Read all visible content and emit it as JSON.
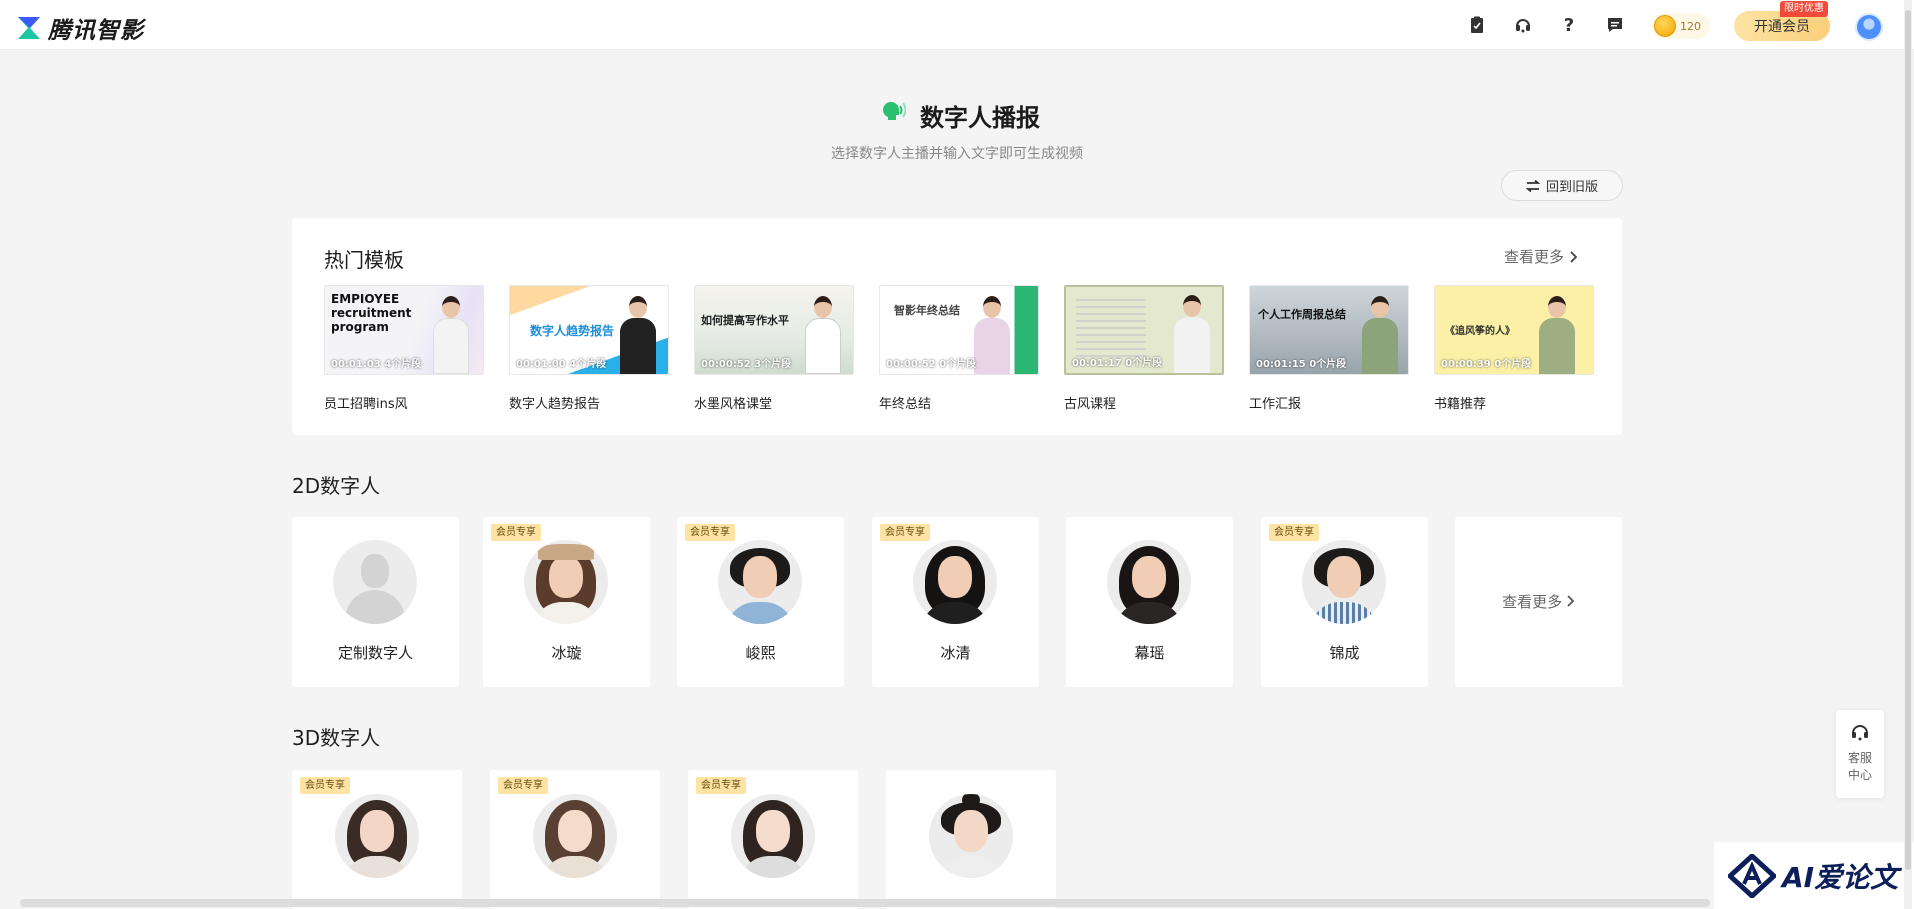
{
  "app": {
    "name": "腾讯智影"
  },
  "topbar": {
    "icons": [
      "clipboard-icon",
      "headset-icon",
      "help-icon",
      "message-icon"
    ],
    "coins": "120",
    "vip_button": "开通会员",
    "vip_tag": "限时优惠"
  },
  "header": {
    "title": "数字人播报",
    "subtitle": "选择数字人主播并输入文字即可生成视频",
    "old_version": "回到旧版"
  },
  "hot": {
    "title": "热门模板",
    "more": "查看更多",
    "templates": [
      {
        "name": "员工招聘ins风",
        "duration": "00:01:03  4个片段",
        "thumb_text": "EMPIOYEE recruitment program"
      },
      {
        "name": "数字人趋势报告",
        "duration": "00:01:00  4个片段",
        "thumb_text": "数字人趋势报告"
      },
      {
        "name": "水墨风格课堂",
        "duration": "00:00:52  3个片段",
        "thumb_text": "如何提高写作水平"
      },
      {
        "name": "年终总结",
        "duration": "00:00:52  0个片段",
        "thumb_text": "智影年终总结"
      },
      {
        "name": "古风课程",
        "duration": "00:01:17  0个片段",
        "thumb_text": ""
      },
      {
        "name": "工作汇报",
        "duration": "00:01:15  0个片段",
        "thumb_text": "个人工作周报总结"
      },
      {
        "name": "书籍推荐",
        "duration": "00:00:39  0个片段",
        "thumb_text": "《追风筝的人》"
      }
    ]
  },
  "section_2d": {
    "title": "2D数字人",
    "badge": "会员专享",
    "more": "查看更多",
    "items": [
      {
        "name": "定制数字人",
        "vip": false
      },
      {
        "name": "冰璇",
        "vip": true
      },
      {
        "name": "峻熙",
        "vip": true
      },
      {
        "name": "冰清",
        "vip": true
      },
      {
        "name": "幕瑶",
        "vip": false
      },
      {
        "name": "锦成",
        "vip": true
      }
    ]
  },
  "section_3d": {
    "title": "3D数字人",
    "badge": "会员专享",
    "items": [
      {
        "vip": true
      },
      {
        "vip": true
      },
      {
        "vip": true
      },
      {
        "vip": false
      }
    ]
  },
  "service": {
    "label": "客服中心"
  },
  "watermark": {
    "text": "AI爱论文"
  },
  "colors": {
    "accent": "#f9cf7a",
    "brand": "#2ac06d",
    "vip_badge": "#fde3a4"
  }
}
